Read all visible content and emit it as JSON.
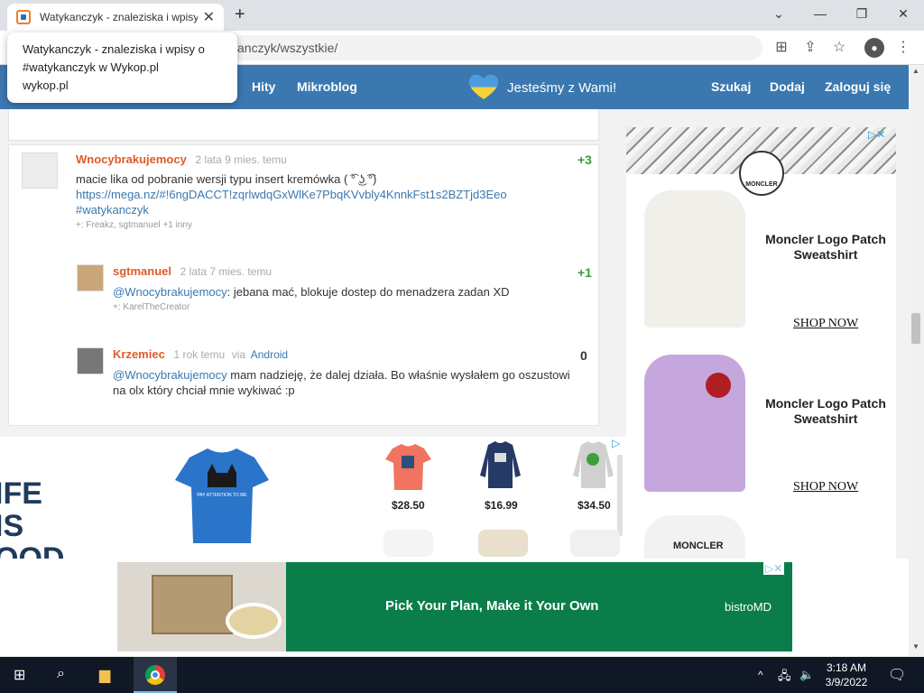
{
  "browser": {
    "tab_title": "Watykanczyk - znaleziska i wpisy",
    "url": "anczyk/wszystkie/",
    "tooltip": {
      "line1": "Watykanczyk - znaleziska i wpisy o",
      "line2": "#watykanczyk w Wykop.pl",
      "line3": "wykop.pl"
    }
  },
  "header": {
    "nav_left": [
      "Hity",
      "Mikroblog"
    ],
    "banner": "Jesteśmy z Wami!",
    "nav_right": [
      "Szukaj",
      "Dodaj",
      "Zaloguj się"
    ]
  },
  "posts": [
    {
      "user": "Wnocybrakujemocy",
      "meta": "2 lata 9 mies. temu",
      "score": "+3",
      "text": "macie lika od pobranie wersji typu insert kremówka ( ͡° ͜ʖ ͡°)",
      "link": "https://mega.nz/#!6ngDACCT!zqrlwdqGxWlKe7PbqKVvbly4KnnkFst1s2BZTjd3Eeo",
      "tag": "#watykanczyk",
      "plus": "+: Freakz, sgtmanuel +1 inny"
    },
    {
      "user": "sgtmanuel",
      "meta": "2 lata 7 mies. temu",
      "score": "+1",
      "mention": "@Wnocybrakujemocy",
      "text": ": jebana mać, blokuje dostep do menadzera zadan XD",
      "plus": "+: KarelTheCreator"
    },
    {
      "user": "Krzemiec",
      "meta": "1 rok temu",
      "via": "via",
      "source": "Android",
      "score": "0",
      "mention": "@Wnocybrakujemocy",
      "text_line1": " mam nadzieję, że dalej działa. Bo właśnie wysłałem go oszustowi",
      "text_line2": "na olx który chciał mnie wykiwać :p"
    }
  ],
  "ad_shirts": {
    "brand": "IFE\nIS\nOOD",
    "prices": [
      "$28.50",
      "$16.99",
      "$34.50"
    ],
    "shirt_text": "PAY ATTENTION TO ME SOMEONE PLS"
  },
  "ad_moncler": {
    "logo": "MONCLER",
    "items": [
      {
        "title": "Moncler Logo Patch Sweatshirt",
        "cta": "SHOP NOW"
      },
      {
        "title": "Moncler Logo Patch Sweatshirt",
        "cta": "SHOP NOW"
      }
    ],
    "third_print": "MONCLER"
  },
  "ad_bistro": {
    "headline": "Pick Your Plan, Make it Your Own",
    "brand": "bistroMD"
  },
  "taskbar": {
    "time": "3:18 AM",
    "date": "3/9/2022"
  },
  "colors": {
    "header": "#3b78b0",
    "username": "#e05b2a",
    "score": "#3a9a3a",
    "ad_green": "#0b7d4b"
  }
}
